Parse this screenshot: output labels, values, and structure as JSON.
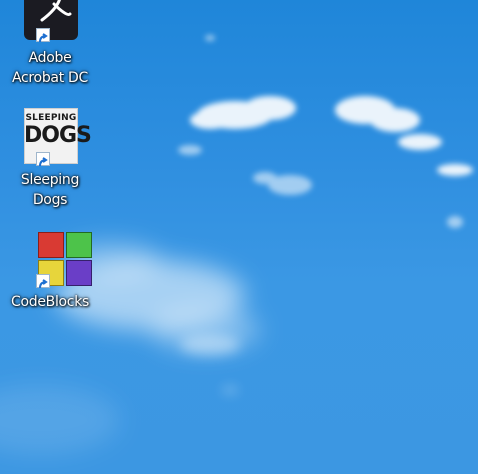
{
  "desktop": {
    "icons": [
      {
        "label": "Adobe\nAcrobat DC",
        "icon": "adobe-acrobat-icon",
        "shortcut": true
      },
      {
        "label": "Sleeping\nDogs",
        "icon": "sleeping-dogs-icon",
        "shortcut": true
      },
      {
        "label": "CodeBlocks",
        "icon": "codeblocks-icon",
        "shortcut": true
      }
    ],
    "dogs_art_text": [
      "SLEEPING",
      "DOGS"
    ]
  },
  "colors": {
    "sky_top": "#1f86d9",
    "sky_bottom": "#3c97e2",
    "label_text": "#ffffff",
    "cube_red": "#d93a33",
    "cube_green": "#4dc34a",
    "cube_yellow": "#e7d53b",
    "cube_purple": "#6a3ec7"
  }
}
